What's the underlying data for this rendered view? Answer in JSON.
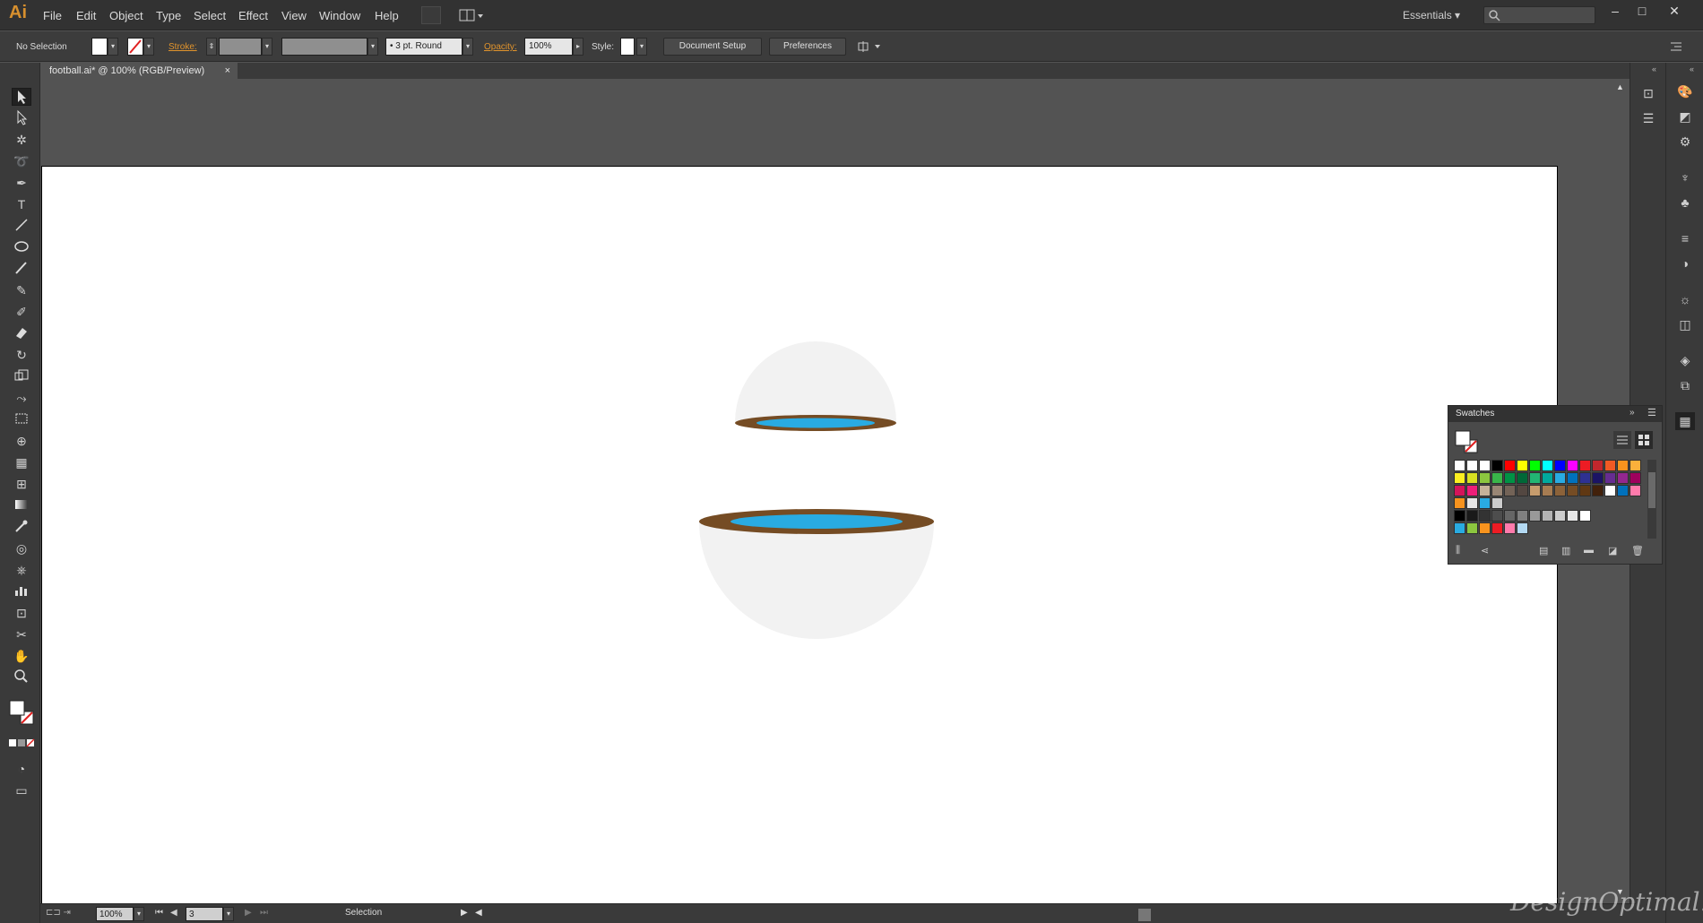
{
  "app": {
    "logo": "Ai",
    "menus": [
      "File",
      "Edit",
      "Object",
      "Type",
      "Select",
      "Effect",
      "View",
      "Window",
      "Help"
    ],
    "workspace": "Essentials",
    "window_controls": [
      "–",
      "□",
      "✕"
    ]
  },
  "control_bar": {
    "selection": "No Selection",
    "stroke_label": "Stroke:",
    "brush": "3 pt. Round",
    "opacity_label": "Opacity:",
    "opacity_value": "100%",
    "style_label": "Style:",
    "document_setup": "Document Setup",
    "preferences": "Preferences"
  },
  "document": {
    "tab_title": "football.ai* @ 100% (RGB/Preview)",
    "tab_close": "×"
  },
  "status": {
    "zoom": "100%",
    "artboard": "3",
    "mode": "Selection"
  },
  "swatches": {
    "title": "Swatches",
    "rows": [
      [
        "#ffffff",
        "#ffffff",
        "#ffffff",
        "#000000",
        "#ff0000",
        "#ffff00",
        "#00ff00",
        "#00ffff",
        "#0000ff",
        "#ff00ff",
        "#ed1c24",
        "#c1272d",
        "#f15a24",
        "#f7931e",
        "#fbb03b"
      ],
      [
        "#fcee21",
        "#d9e021",
        "#8cc63f",
        "#39b54a",
        "#009245",
        "#006837",
        "#22b573",
        "#00a99d",
        "#29abe2",
        "#0071bc",
        "#2e3192",
        "#1b1464",
        "#662d91",
        "#93278f",
        "#9e005d"
      ],
      [
        "#d4145a",
        "#ed1e79",
        "#c7b299",
        "#998675",
        "#736357",
        "#534741",
        "#c69c6d",
        "#a67c52",
        "#8c6239",
        "#754c24",
        "#603813",
        "#42210b",
        "#ffffff",
        "#0071bc",
        "#ff7bac"
      ],
      [
        "#f7931e",
        "#e6e6e6",
        "#29abe2",
        "#cccccc"
      ],
      [
        "#000000",
        "#1a1a1a",
        "#333333",
        "#4d4d4d",
        "#666666",
        "#808080",
        "#999999",
        "#b3b3b3",
        "#cccccc",
        "#e6e6e6",
        "#ffffff"
      ],
      [
        "#29abe2",
        "#8cc63f",
        "#f7931e",
        "#ed1c24",
        "#ff7bac",
        "#b3d9f2"
      ]
    ]
  },
  "watermark": "DesignOptimal.com",
  "colors": {
    "ball_fill": "#f2f2f2",
    "ring_brown": "#754c24",
    "ring_blue": "#29abe2"
  }
}
